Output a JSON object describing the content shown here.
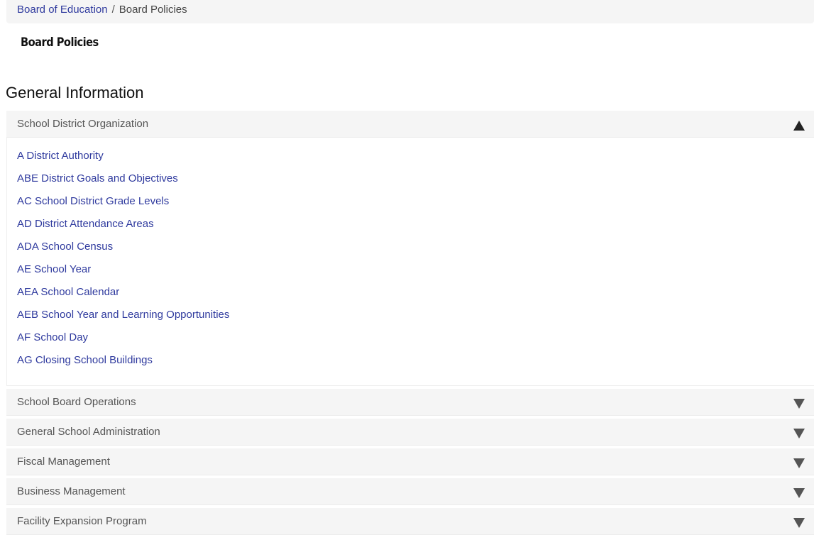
{
  "breadcrumb": {
    "parent": "Board of Education",
    "separator": "/",
    "current": "Board Policies"
  },
  "page_title": "Board Policies",
  "section_heading": "General Information",
  "accordion": {
    "open_section": {
      "title": "School District Organization",
      "icon": "triangle-up-icon",
      "links": [
        "A District Authority",
        "ABE District Goals and Objectives",
        "AC School District Grade Levels",
        "AD District Attendance Areas",
        "ADA School Census",
        "AE School Year",
        "AEA School Calendar",
        "AEB School Year and Learning Opportunities",
        "AF School Day",
        "AG Closing School Buildings"
      ]
    },
    "closed_sections": [
      {
        "title": "School Board Operations",
        "icon": "triangle-down-icon"
      },
      {
        "title": "General School Administration",
        "icon": "triangle-down-icon"
      },
      {
        "title": "Fiscal Management",
        "icon": "triangle-down-icon"
      },
      {
        "title": "Business Management",
        "icon": "triangle-down-icon"
      },
      {
        "title": "Facility Expansion Program",
        "icon": "triangle-down-icon"
      }
    ]
  },
  "colors": {
    "link": "#2f3a9e",
    "panel_bg": "#f5f5f5",
    "header_text": "#555555"
  }
}
